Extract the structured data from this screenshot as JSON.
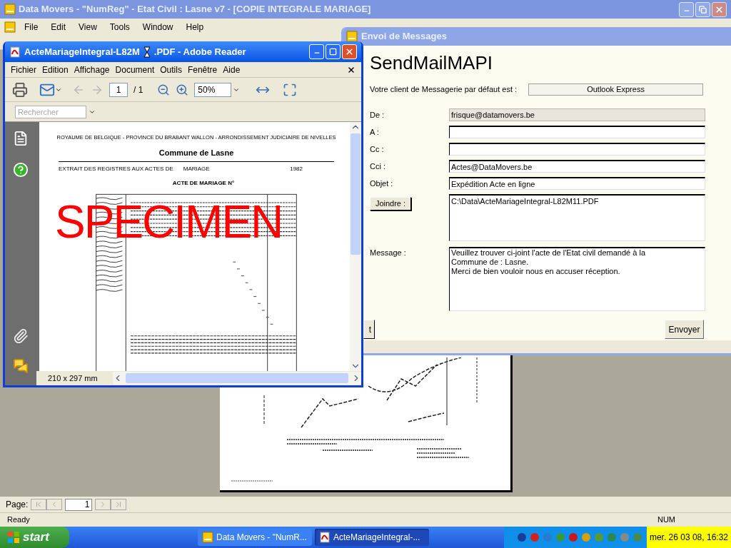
{
  "main_window": {
    "title": "Data Movers - \"NumReg\" - Etat Civil : Lasne  v7 - [COPIE INTEGRALE MARIAGE]",
    "menu": [
      "File",
      "Edit",
      "View",
      "Tools",
      "Window",
      "Help"
    ],
    "page_nav": {
      "label": "Page:",
      "value": "1"
    },
    "status_bar": {
      "left": "Ready",
      "right": "NUM"
    }
  },
  "reader_window": {
    "title_start": "ActeMariageIntegral-L82M",
    "title_end": ".PDF - Adobe Reader",
    "menu": [
      "Fichier",
      "Edition",
      "Affichage",
      "Document",
      "Outils",
      "Fenêtre",
      "Aide"
    ],
    "page_field": "1",
    "page_total": "/ 1",
    "zoom": "50%",
    "search_placeholder": "Rechercher",
    "document": {
      "header": "ROYAUME DE BELGIQUE - PROVINCE DU BRABANT WALLON - ARRONDISSEMENT JUDICIAIRE DE NIVELLES",
      "commune": "Commune de Lasne",
      "extract_label": "EXTRAIT DES REGISTRES AUX ACTES DE",
      "act_type": "MARIAGE",
      "year": "1982",
      "act_title": "ACTE DE MARIAGE N°",
      "stamp": "SPECIMEN"
    },
    "page_size": "210 x 297 mm"
  },
  "dialog": {
    "title": "Envoi de Messages",
    "heading": "SendMailMAPI",
    "client_label": "Votre client de Messagerie par défaut est :",
    "client_value": "Outlook Express",
    "fields": [
      {
        "label": "De :",
        "value": "frisque@datamovers.be",
        "disabled": true
      },
      {
        "label": "A :",
        "disabled": false
      },
      {
        "label": "Cc :",
        "disabled": false
      },
      {
        "label": "Cci :",
        "value": "Actes@DataMovers.be",
        "disabled": false
      },
      {
        "label": "Objet :",
        "value": "Expédition Acte en ligne",
        "disabled": false
      }
    ],
    "attach_button": "Joindre :",
    "attachment": "C:\\Data\\ActeMariageIntegral-L82M11.PDF",
    "message_label": "Message :",
    "message_lines": [
      "Veuillez trouver ci-joint l'acte de l'Etat civil demandé à la",
      "Commune de : Lasne.",
      "Merci de bien vouloir nous en accuser réception."
    ],
    "left_button": "t",
    "send_button": "Envoyer"
  },
  "taskbar": {
    "start": "start",
    "tasks": [
      {
        "label": "Data Movers - \"NumR...",
        "selected": false
      },
      {
        "label": "ActeMariageIntegral-...",
        "selected": true
      }
    ],
    "clock": "mer. 26 03 08, 16:32"
  }
}
